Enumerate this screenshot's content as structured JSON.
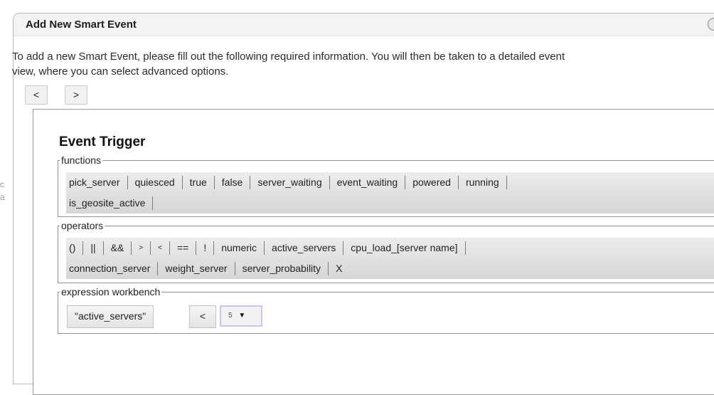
{
  "dialog": {
    "title": "Add New Smart Event",
    "intro_line1": "To add a new Smart Event, please fill out the following required information. You will then be taken to a detailed event",
    "intro_line2": "view, where you can select advanced options."
  },
  "nav": {
    "prev_label": "<",
    "next_label": ">"
  },
  "event_trigger": {
    "title": "Event Trigger",
    "functions": {
      "legend": "functions",
      "row1": [
        "pick_server",
        "quiesced",
        "true",
        "false",
        "server_waiting",
        "event_waiting",
        "powered",
        "running"
      ],
      "row2": [
        "is_geosite_active"
      ]
    },
    "operators": {
      "legend": "operators",
      "row1": [
        "()",
        "||",
        "&&",
        ">",
        "<",
        "==",
        "!",
        "numeric",
        "active_servers",
        "cpu_load_[server name]"
      ],
      "row2": [
        "connection_server",
        "weight_server",
        "server_probability",
        "X"
      ]
    },
    "workbench": {
      "legend": "expression workbench",
      "value_token": "\"active_servers\"",
      "operator_token": "<",
      "select_value": "5",
      "select_arrow": "▼"
    }
  },
  "icons": {
    "close": "close-icon"
  }
}
